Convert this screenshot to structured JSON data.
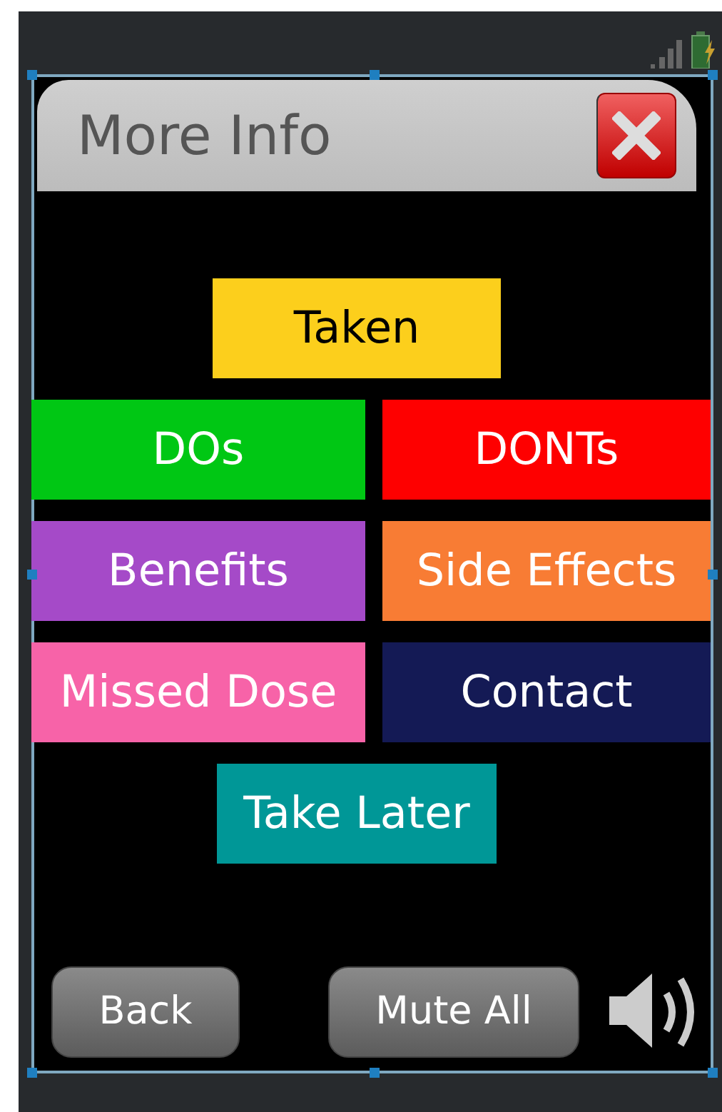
{
  "window": {
    "title": "More Info"
  },
  "options": [
    [
      {
        "label": "Taken",
        "color": "#fccf1c"
      }
    ],
    [
      {
        "label": "DOs",
        "color": "#00c714"
      },
      {
        "label": "DONTs",
        "color": "#fe0000"
      }
    ],
    [
      {
        "label": "Benefits",
        "color": "#a54ac8"
      },
      {
        "label": "Side Effects",
        "color": "#f87c34"
      }
    ],
    [
      {
        "label": "Missed Dose",
        "color": "#f763a8"
      },
      {
        "label": "Contact",
        "color": "#141a55"
      }
    ],
    [
      {
        "label": "Take Later",
        "color": "#009797"
      }
    ]
  ],
  "buttons": [
    "Back",
    "Mute All"
  ]
}
